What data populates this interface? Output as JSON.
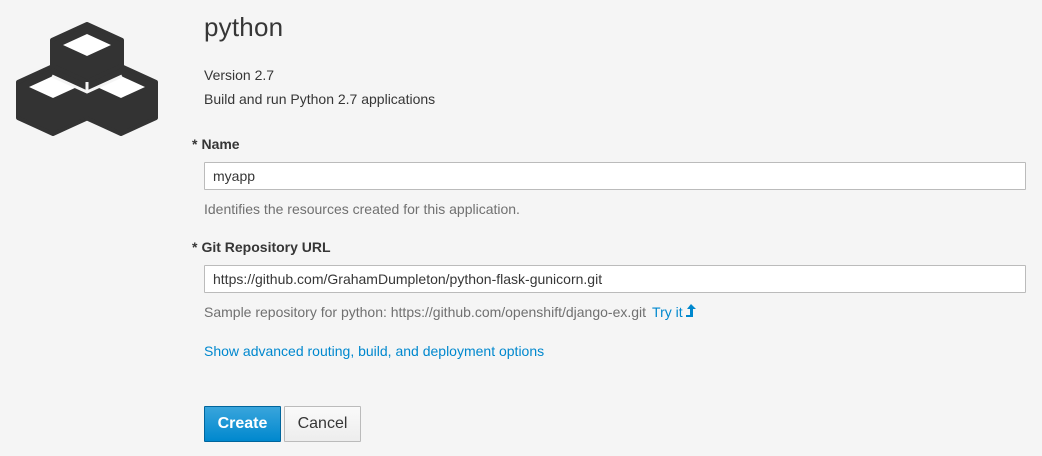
{
  "template": {
    "title": "python",
    "version": "Version 2.7",
    "description": "Build and run Python 2.7 applications",
    "icon": "cubes-icon"
  },
  "form": {
    "name": {
      "required_mark": "*",
      "label": "Name",
      "value": "myapp",
      "help": "Identifies the resources created for this application."
    },
    "git": {
      "required_mark": "*",
      "label": "Git Repository URL",
      "value": "https://github.com/GrahamDumpleton/python-flask-gunicorn.git",
      "help": "Sample repository for python: https://github.com/openshift/django-ex.git",
      "try_label": "Try it",
      "try_icon": "level-up-icon"
    },
    "advanced_link": "Show advanced routing, build, and deployment options"
  },
  "buttons": {
    "create": "Create",
    "cancel": "Cancel"
  },
  "colors": {
    "link": "#0088ce",
    "primary": "#0088ce",
    "background": "#f5f5f5",
    "icon": "#333333"
  }
}
